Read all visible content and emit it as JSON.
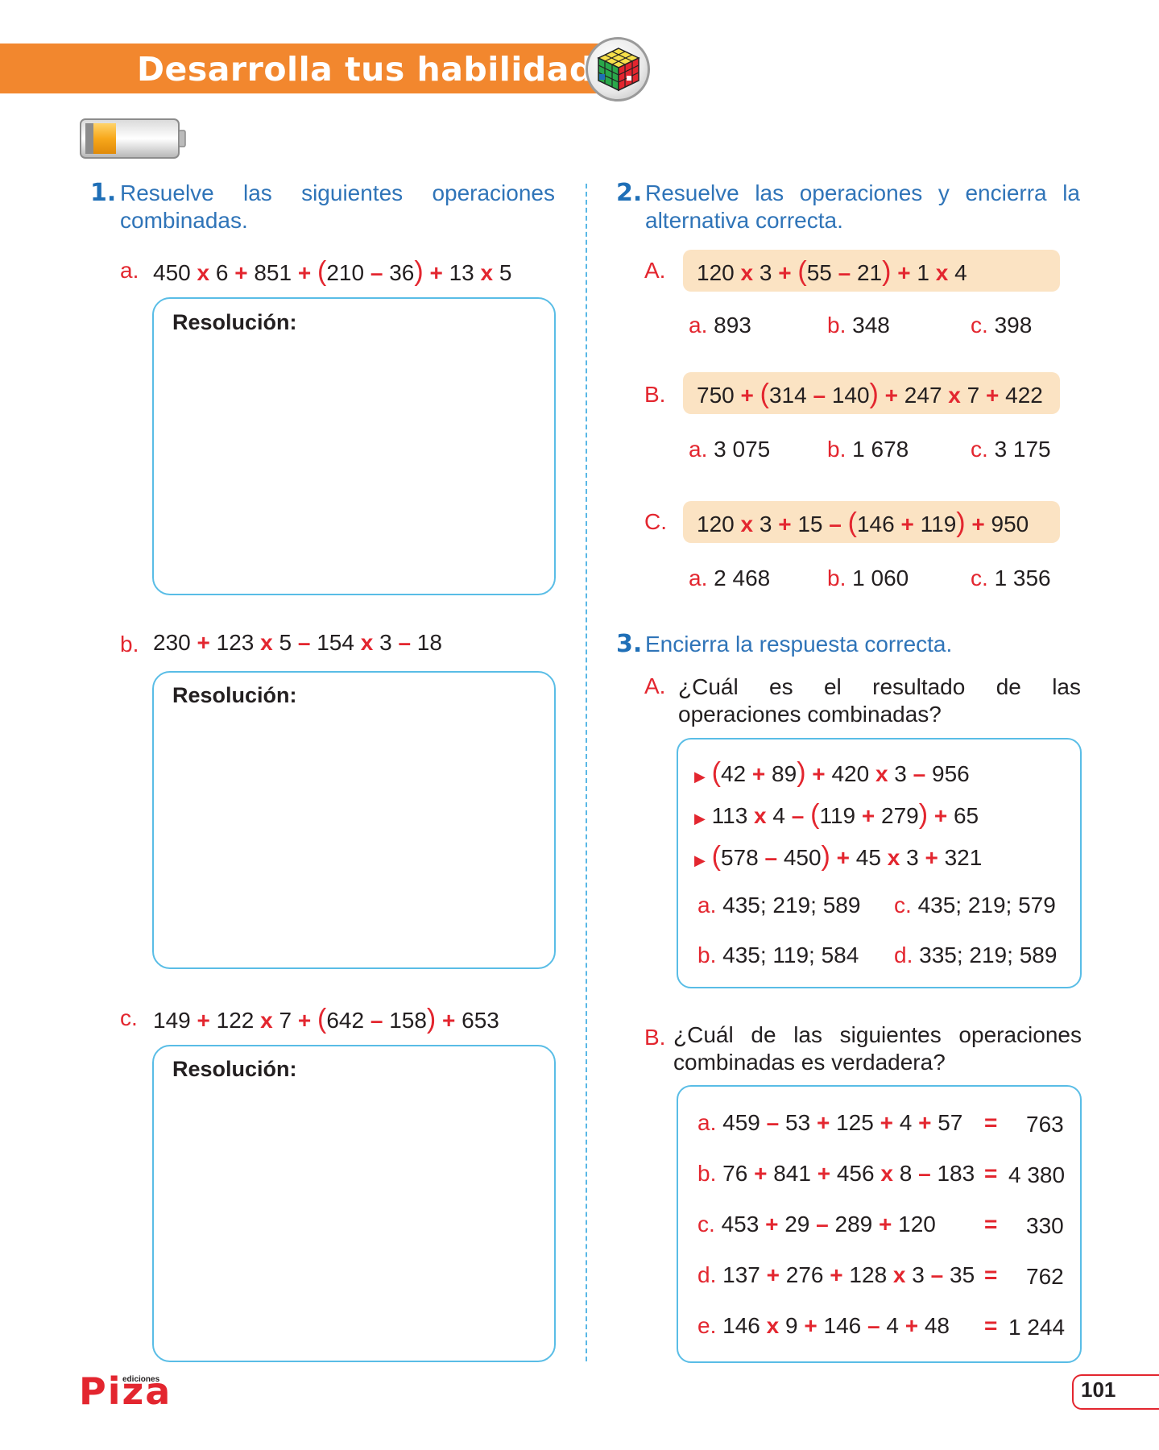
{
  "header": {
    "title": "Desarrolla tus habilidades",
    "icon": "rubiks-cube-icon"
  },
  "q1": {
    "number": "1.",
    "text_line1": "Resuelve las siguientes operaciones",
    "text_line2": "combinadas.",
    "items": [
      {
        "letter": "a.",
        "tokens": [
          "450",
          "x",
          "6",
          "+",
          "851",
          "+",
          "(",
          "210",
          "–",
          "36",
          ")",
          "+",
          "13",
          "x",
          "5"
        ],
        "box_label": "Resolución:"
      },
      {
        "letter": "b.",
        "tokens": [
          "230",
          "+",
          "123",
          "x",
          "5",
          "–",
          "154",
          "x",
          "3",
          "–",
          "18"
        ],
        "box_label": "Resolución:"
      },
      {
        "letter": "c.",
        "tokens": [
          "149",
          "+",
          "122",
          "x",
          "7",
          "+",
          "(",
          "642",
          "–",
          "158",
          ")",
          "+",
          "653"
        ],
        "box_label": "Resolución:"
      }
    ]
  },
  "q2": {
    "number": "2.",
    "text_line1": "Resuelve las operaciones y encierra la",
    "text_line2": "alternativa correcta.",
    "items": [
      {
        "letter": "A.",
        "tokens": [
          "120",
          "x",
          "3",
          "+",
          "(",
          "55",
          "–",
          "21",
          ")",
          "+",
          "1",
          "x",
          "4"
        ],
        "options": [
          {
            "l": "a.",
            "v": "893"
          },
          {
            "l": "b.",
            "v": "348"
          },
          {
            "l": "c.",
            "v": "398"
          }
        ]
      },
      {
        "letter": "B.",
        "tokens": [
          "750",
          "+",
          "(",
          "314",
          "–",
          "140",
          ")",
          "+",
          "247",
          "x",
          "7",
          "+",
          "422"
        ],
        "options": [
          {
            "l": "a.",
            "v": "3 075"
          },
          {
            "l": "b.",
            "v": "1 678"
          },
          {
            "l": "c.",
            "v": "3 175"
          }
        ]
      },
      {
        "letter": "C.",
        "tokens": [
          "120",
          "x",
          "3",
          "+",
          "15",
          "–",
          "(",
          "146",
          "+",
          "119",
          ")",
          "+",
          "950"
        ],
        "options": [
          {
            "l": "a.",
            "v": "2 468"
          },
          {
            "l": "b.",
            "v": "1 060"
          },
          {
            "l": "c.",
            "v": "1 356"
          }
        ]
      }
    ]
  },
  "q3": {
    "number": "3.",
    "text": "Encierra la respuesta correcta.",
    "A": {
      "letter": "A.",
      "line1": "¿Cuál es el resultado de las",
      "line2": "operaciones combinadas?",
      "exprs": [
        [
          "(",
          "42",
          "+",
          "89",
          ")",
          "+",
          "420",
          "x",
          "3",
          "–",
          "956"
        ],
        [
          "113",
          "x",
          "4",
          "–",
          "(",
          "119",
          "+",
          "279",
          ")",
          "+",
          "65"
        ],
        [
          "(",
          "578",
          "–",
          "450",
          ")",
          "+",
          "45",
          "x",
          "3",
          "+",
          "321"
        ]
      ],
      "options": [
        {
          "l": "a.",
          "v": "435; 219; 589"
        },
        {
          "l": "c.",
          "v": "435; 219; 579"
        },
        {
          "l": "b.",
          "v": "435; 119; 584"
        },
        {
          "l": "d.",
          "v": "335; 219; 589"
        }
      ]
    },
    "B": {
      "letter": "B.",
      "line1": "¿Cuál de las siguientes operaciones",
      "line2": "combinadas es verdadera?",
      "rows": [
        {
          "l": "a.",
          "tokens": [
            "459",
            "–",
            "53",
            "+",
            "125",
            "+",
            "4",
            "+",
            "57"
          ],
          "eq": "=",
          "result": "763"
        },
        {
          "l": "b.",
          "tokens": [
            "76",
            "+",
            "841",
            "+",
            "456",
            "x",
            "8",
            "–",
            "183"
          ],
          "eq": "=",
          "result": "4 380"
        },
        {
          "l": "c.",
          "tokens": [
            "453",
            "+",
            "29",
            "–",
            "289",
            "+",
            "120"
          ],
          "eq": "=",
          "result": "330"
        },
        {
          "l": "d.",
          "tokens": [
            "137",
            "+",
            "276",
            "+",
            "128",
            "x",
            "3",
            "–",
            "35"
          ],
          "eq": "=",
          "result": "762"
        },
        {
          "l": "e.",
          "tokens": [
            "146",
            "x",
            "9",
            "+",
            "146",
            "–",
            "4",
            "+",
            "48"
          ],
          "eq": "=",
          "result": "1 244"
        }
      ]
    }
  },
  "footer": {
    "logo": "Piza",
    "logo_small": "ediciones",
    "page": "101"
  },
  "colors": {
    "orange": "#f2872e",
    "red": "#e3262f",
    "blue": "#2f74b8",
    "box_border": "#59bde6",
    "peach": "#fbe3c3"
  }
}
